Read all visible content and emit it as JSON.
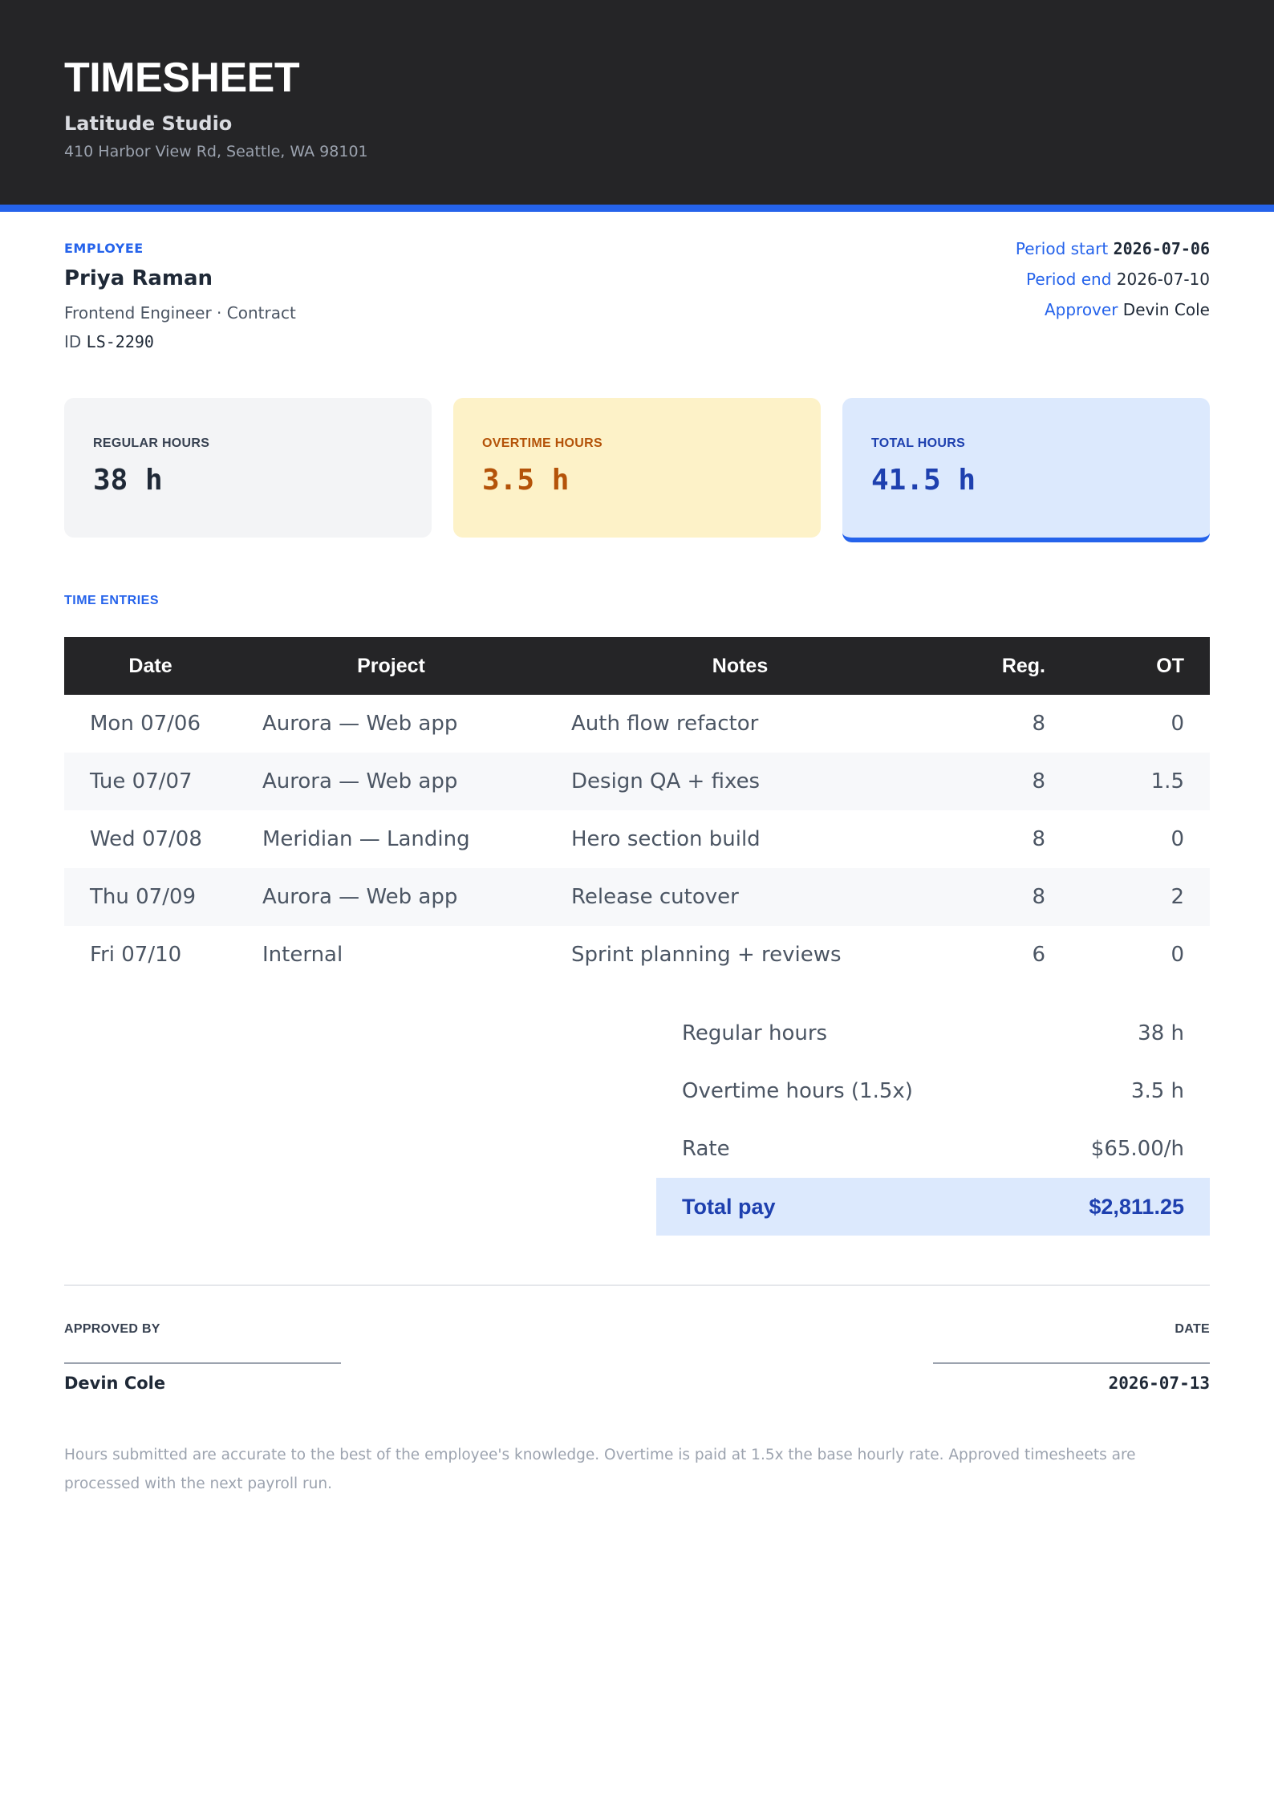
{
  "header": {
    "title": "TIMESHEET",
    "company": "Latitude Studio",
    "address": "410 Harbor View Rd, Seattle, WA 98101"
  },
  "employee": {
    "section_label": "EMPLOYEE",
    "name": "Priya Raman",
    "role": "Frontend Engineer · Contract",
    "id_label": "ID",
    "id": "LS-2290"
  },
  "period": {
    "start_label": "Period start",
    "start": "2026-07-06",
    "end_label": "Period end",
    "end": "2026-07-10",
    "approver_label": "Approver",
    "approver": "Devin Cole"
  },
  "cards": {
    "regular": {
      "label": "REGULAR HOURS",
      "value": "38 h"
    },
    "overtime": {
      "label": "OVERTIME HOURS",
      "value": "3.5 h"
    },
    "total": {
      "label": "TOTAL HOURS",
      "value": "41.5 h"
    }
  },
  "entries": {
    "section_label": "TIME ENTRIES",
    "columns": [
      "Date",
      "Project",
      "Notes",
      "Reg.",
      "OT"
    ],
    "rows": [
      {
        "date": "Mon 07/06",
        "project": "Aurora — Web app",
        "notes": "Auth flow refactor",
        "reg": "8",
        "ot": "0"
      },
      {
        "date": "Tue 07/07",
        "project": "Aurora — Web app",
        "notes": "Design QA + fixes",
        "reg": "8",
        "ot": "1.5"
      },
      {
        "date": "Wed 07/08",
        "project": "Meridian — Landing",
        "notes": "Hero section build",
        "reg": "8",
        "ot": "0"
      },
      {
        "date": "Thu 07/09",
        "project": "Aurora — Web app",
        "notes": "Release cutover",
        "reg": "8",
        "ot": "2"
      },
      {
        "date": "Fri 07/10",
        "project": "Internal",
        "notes": "Sprint planning + reviews",
        "reg": "6",
        "ot": "0"
      }
    ]
  },
  "summary": {
    "regular_label": "Regular hours",
    "regular": "38 h",
    "overtime_label": "Overtime hours (1.5x)",
    "overtime": "3.5 h",
    "rate_label": "Rate",
    "rate": "$65.00/h",
    "total_label": "Total pay",
    "total": "$2,811.25"
  },
  "signoff": {
    "approved_by_label": "APPROVED BY",
    "approved_by": "Devin Cole",
    "date_label": "DATE",
    "date": "2026-07-13"
  },
  "footnote": "Hours submitted are accurate to the best of the employee's knowledge. Overtime is paid at 1.5x the base hourly rate. Approved timesheets are processed with the next payroll run.",
  "colors": {
    "accent": "#2563eb",
    "header_bg": "#252527",
    "overtime": "#b45309",
    "total": "#1e40af"
  }
}
